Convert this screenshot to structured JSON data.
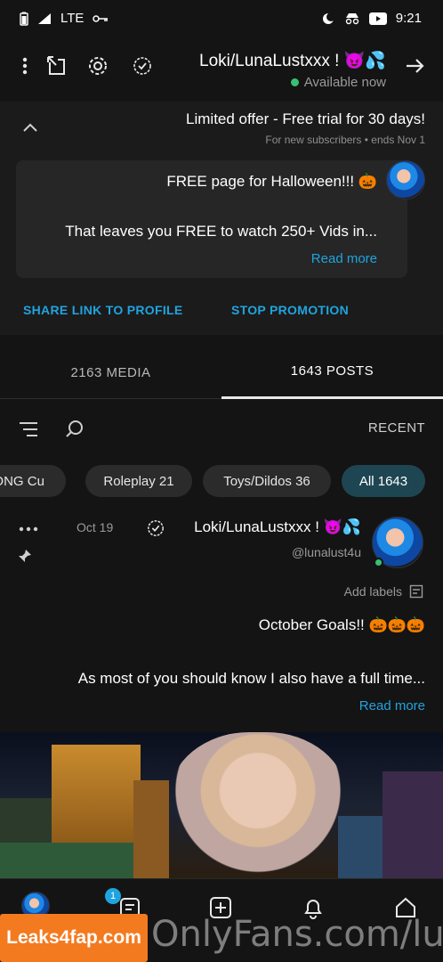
{
  "status_bar": {
    "time": "9:21",
    "network": "LTE"
  },
  "header": {
    "title": "Loki/LunaLustxxx ! 😈💦",
    "presence": "Available now"
  },
  "promo": {
    "title": "Limited offer - Free trial for 30 days!",
    "subtitle": "For new subscribers  •  ends Nov 1",
    "card_title": "FREE page for Halloween!!! 🎃",
    "card_text": "That leaves you FREE to watch 250+ Vids in...",
    "read_more": "Read more",
    "stop_promotion": "STOP PROMOTION",
    "share_link": "SHARE LINK TO PROFILE"
  },
  "tabs": {
    "posts": "1643 POSTS",
    "media": "2163 MEDIA"
  },
  "filter": {
    "sort_label": "RECENT"
  },
  "chips": [
    {
      "label": "All 1643"
    },
    {
      "label": "Toys/Dildos 36"
    },
    {
      "label": "Roleplay 21"
    },
    {
      "label": "LONG Cu"
    }
  ],
  "post": {
    "author": "Loki/LunaLustxxx ! 😈💦",
    "handle": "@lunalust4u",
    "date": "Oct 19",
    "add_labels": "Add labels",
    "title": "October Goals!! 🎃🎃🎃",
    "body": "As most of you should know I also have a full time...",
    "read_more": "Read more"
  },
  "bottom_nav": {
    "badge": "1"
  },
  "watermark": {
    "logo": "Leaks4fap.com",
    "text": "OnlyFans.com/lun"
  },
  "colors": {
    "accent": "#1fa4e0",
    "online": "#38c172",
    "background": "#141414",
    "card": "#262626",
    "chip_active": "#1e4552"
  }
}
